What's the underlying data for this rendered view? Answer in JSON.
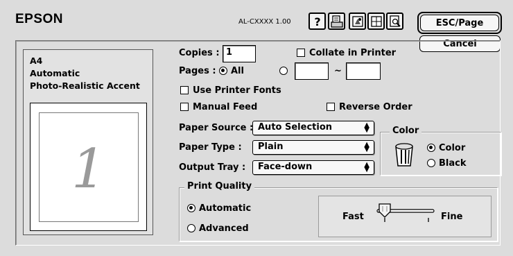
{
  "header": {
    "brand": "EPSON",
    "model": "AL-CXXXX 1.00",
    "toolbar_icons": [
      "help-icon",
      "print-setup-icon",
      "utility-icon",
      "layout-icon",
      "preview-icon"
    ],
    "esc_page_label": "ESC/Page",
    "cancel_label": "Cancel"
  },
  "summary": {
    "paper_size": "A4",
    "mode": "Automatic",
    "setting": "Photo-Realistic Accent",
    "page_number": "1"
  },
  "copies": {
    "label": "Copies :",
    "value": "1"
  },
  "collate": {
    "label": "Collate in Printer",
    "checked": false
  },
  "pages": {
    "label": "Pages :",
    "all_label": "All",
    "selected": "all",
    "from": "",
    "to": "",
    "range_sep": "~"
  },
  "use_printer_fonts": {
    "label": "Use Printer Fonts",
    "checked": false
  },
  "manual_feed": {
    "label": "Manual Feed",
    "checked": false
  },
  "reverse_order": {
    "label": "Reverse Order",
    "checked": false
  },
  "paper_source": {
    "label": "Paper Source :",
    "value": "Auto Selection"
  },
  "paper_type": {
    "label": "Paper Type :",
    "value": "Plain"
  },
  "output_tray": {
    "label": "Output Tray :",
    "value": "Face-down"
  },
  "color": {
    "title": "Color",
    "options": [
      "Color",
      "Black"
    ],
    "selected": "Color"
  },
  "print_quality": {
    "title": "Print Quality",
    "options": [
      "Automatic",
      "Advanced"
    ],
    "selected": "Automatic",
    "slider_left_label": "Fast",
    "slider_right_label": "Fine",
    "slider_position": 0
  }
}
